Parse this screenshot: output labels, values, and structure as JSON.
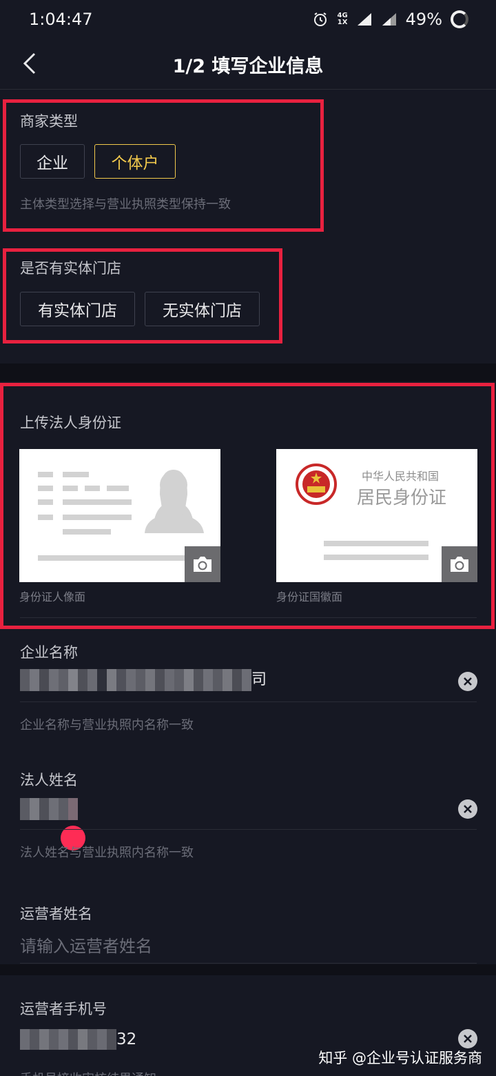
{
  "status": {
    "time": "1:04:47",
    "network_top": "4G",
    "network_bottom": "1X",
    "battery": "49%"
  },
  "header": {
    "title": "1/2 填写企业信息"
  },
  "merchant_type": {
    "label": "商家类型",
    "options": [
      "企业",
      "个体户"
    ],
    "selected": "个体户",
    "hint": "主体类型选择与营业执照类型保持一致"
  },
  "store": {
    "label": "是否有实体门店",
    "options": [
      "有实体门店",
      "无实体门店"
    ]
  },
  "id_upload": {
    "label": "上传法人身份证",
    "front_caption": "身份证人像面",
    "back_caption": "身份证国徽面",
    "back_card_country": "中华人民共和国",
    "back_card_title": "居民身份证"
  },
  "company_name": {
    "label": "企业名称",
    "hint": "企业名称与营业执照内名称一致",
    "value_suffix": "司"
  },
  "legal_name": {
    "label": "法人姓名",
    "hint": "法人姓名与营业执照内名称一致"
  },
  "operator_name": {
    "label": "运营者姓名",
    "placeholder": "请输入运营者姓名"
  },
  "operator_phone": {
    "label": "运营者手机号",
    "value_suffix": "32",
    "hint_partial": "手机号接收审核结果通知"
  },
  "watermark": "知乎 @企业号认证服务商",
  "colors": {
    "accent_selected": "#f2c94c",
    "annotation_red": "#e8213f",
    "background": "#161823",
    "brand_pink": "#fe2c55"
  }
}
